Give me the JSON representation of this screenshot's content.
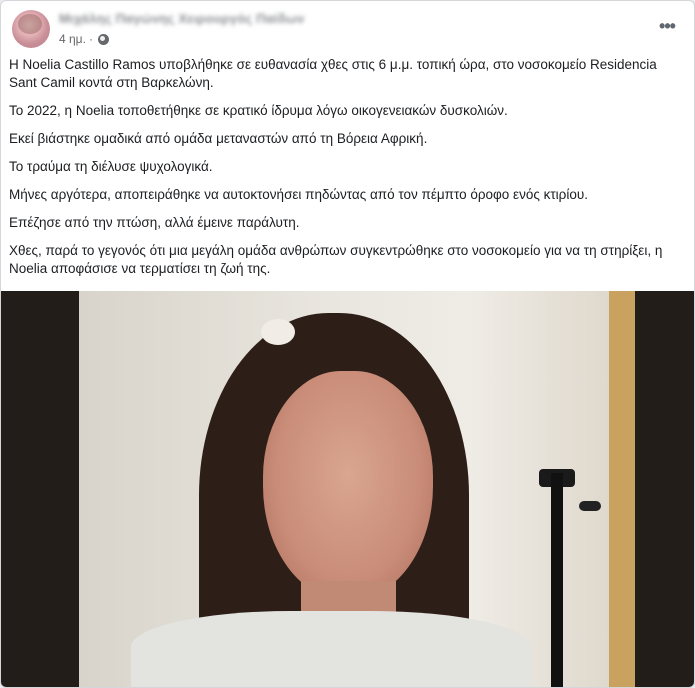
{
  "post": {
    "author": "Μιχάλης Παγώνης Χειρουργός Παίδων",
    "time": "4 ημ.",
    "separator": "·",
    "more_label": "•••",
    "paragraphs": [
      "Η Noelia Castillo Ramos υποβλήθηκε σε ευθανασία χθες στις 6 μ.μ. τοπική ώρα, στο νοσοκομείο Residencia Sant Camil κοντά στη Βαρκελώνη.",
      "Το 2022, η Noelia τοποθετήθηκε σε κρατικό ίδρυμα λόγω οικογενειακών δυσκολιών.",
      "Εκεί βιάστηκε ομαδικά από ομάδα μεταναστών από τη Βόρεια Αφρική.",
      "Το τραύμα τη διέλυσε ψυχολογικά.",
      "Μήνες αργότερα, αποπειράθηκε να αυτοκτονήσει πηδώντας από τον πέμπτο όροφο ενός κτιρίου.",
      "Επέζησε από την πτώση, αλλά έμεινε παράλυτη.",
      "Χθες, παρά το γεγονός ότι μια μεγάλη ομάδα ανθρώπων συγκεντρώθηκε στο νοσοκομείο για να τη στηρίξει, η Noelia αποφάσισε να τερματίσει τη ζωή της."
    ]
  },
  "icons": {
    "privacy": "globe-icon",
    "more": "more-options-icon"
  },
  "colors": {
    "card_bg": "#ffffff",
    "text": "#1c1e21",
    "meta": "#65676b"
  }
}
